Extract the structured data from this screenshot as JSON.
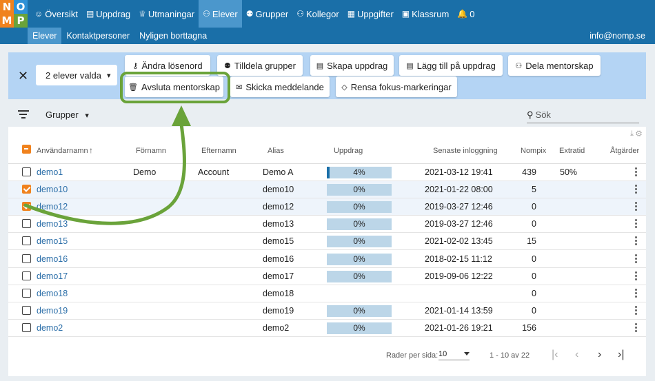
{
  "logo": {
    "letters": [
      "N",
      "O",
      "M",
      "P"
    ],
    "colors": [
      "#f0821e",
      "#2e91d6",
      "#f0821e",
      "#6aa33a"
    ]
  },
  "nav": {
    "items": [
      {
        "label": "Översikt",
        "icon": "smiley-icon",
        "glyph": "☺"
      },
      {
        "label": "Uppdrag",
        "icon": "list-icon",
        "glyph": "▤"
      },
      {
        "label": "Utmaningar",
        "icon": "trophy-icon",
        "glyph": "♕"
      },
      {
        "label": "Elever",
        "icon": "user-icon",
        "glyph": "⚇"
      },
      {
        "label": "Grupper",
        "icon": "group-icon",
        "glyph": "⚉"
      },
      {
        "label": "Kollegor",
        "icon": "colleagues-icon",
        "glyph": "⚇"
      },
      {
        "label": "Uppgifter",
        "icon": "grid-icon",
        "glyph": "▦"
      },
      {
        "label": "Klassrum",
        "icon": "classroom-icon",
        "glyph": "▣"
      },
      {
        "label": "0",
        "icon": "bell-icon",
        "glyph": "🔔"
      }
    ],
    "active": "Elever"
  },
  "subnav": {
    "items": [
      "Elever",
      "Kontaktpersoner",
      "Nyligen borttagna"
    ],
    "user_email": "info@nomp.se"
  },
  "actions": {
    "selected_label": "2 elever valda",
    "buttons": [
      {
        "label": "Ändra lösenord",
        "icon": "key-icon",
        "glyph": "⚷"
      },
      {
        "label": "Tilldela grupper",
        "icon": "group-icon",
        "glyph": "⚉"
      },
      {
        "label": "Skapa uppdrag",
        "icon": "task-icon",
        "glyph": "▤"
      },
      {
        "label": "Lägg till på uppdrag",
        "icon": "add-task-icon",
        "glyph": "▤"
      },
      {
        "label": "Dela mentorskap",
        "icon": "share-mentor-icon",
        "glyph": "⚇"
      },
      {
        "label": "Avsluta mentorskap",
        "icon": "trash-icon",
        "glyph": "🗑"
      },
      {
        "label": "Skicka meddelande",
        "icon": "mail-icon",
        "glyph": "✉"
      },
      {
        "label": "Rensa fokus-markeringar",
        "icon": "eraser-icon",
        "glyph": "◇"
      }
    ]
  },
  "filter": {
    "groups_label": "Grupper",
    "search_placeholder": "Sök"
  },
  "table": {
    "headers": [
      "Användarnamn",
      "Förnamn",
      "Efternamn",
      "Alias",
      "Uppdrag",
      "Senaste inloggning",
      "Nompix",
      "Extratid",
      "Åtgärder"
    ],
    "rows": [
      {
        "username": "demo1",
        "first": "Demo",
        "last": "Account",
        "alias": "Demo A",
        "progress": "4%",
        "progress_value": 4,
        "login": "2021-03-12 19:41",
        "nompix": "439",
        "extra": "50%",
        "selected": false
      },
      {
        "username": "demo10",
        "first": "",
        "last": "",
        "alias": "demo10",
        "progress": "0%",
        "progress_value": 0,
        "login": "2021-01-22 08:00",
        "nompix": "5",
        "extra": "",
        "selected": true
      },
      {
        "username": "demo12",
        "first": "",
        "last": "",
        "alias": "demo12",
        "progress": "0%",
        "progress_value": 0,
        "login": "2019-03-27 12:46",
        "nompix": "0",
        "extra": "",
        "selected": true
      },
      {
        "username": "demo13",
        "first": "",
        "last": "",
        "alias": "demo13",
        "progress": "0%",
        "progress_value": 0,
        "login": "2019-03-27 12:46",
        "nompix": "0",
        "extra": "",
        "selected": false
      },
      {
        "username": "demo15",
        "first": "",
        "last": "",
        "alias": "demo15",
        "progress": "0%",
        "progress_value": 0,
        "login": "2021-02-02 13:45",
        "nompix": "15",
        "extra": "",
        "selected": false
      },
      {
        "username": "demo16",
        "first": "",
        "last": "",
        "alias": "demo16",
        "progress": "0%",
        "progress_value": 0,
        "login": "2018-02-15 11:12",
        "nompix": "0",
        "extra": "",
        "selected": false
      },
      {
        "username": "demo17",
        "first": "",
        "last": "",
        "alias": "demo17",
        "progress": "0%",
        "progress_value": 0,
        "login": "2019-09-06 12:22",
        "nompix": "0",
        "extra": "",
        "selected": false
      },
      {
        "username": "demo18",
        "first": "",
        "last": "",
        "alias": "demo18",
        "progress": "",
        "progress_value": null,
        "login": "",
        "nompix": "0",
        "extra": "",
        "selected": false
      },
      {
        "username": "demo19",
        "first": "",
        "last": "",
        "alias": "demo19",
        "progress": "0%",
        "progress_value": 0,
        "login": "2021-01-14 13:59",
        "nompix": "0",
        "extra": "",
        "selected": false
      },
      {
        "username": "demo2",
        "first": "",
        "last": "",
        "alias": "demo2",
        "progress": "0%",
        "progress_value": 0,
        "login": "2021-01-26 19:21",
        "nompix": "156",
        "extra": "",
        "selected": false
      }
    ]
  },
  "pagination": {
    "rows_per_page_label": "Rader per sida:",
    "rows_per_page": "10",
    "range": "1 - 10 av 22"
  },
  "annotation": {
    "color": "#6aa33a"
  }
}
